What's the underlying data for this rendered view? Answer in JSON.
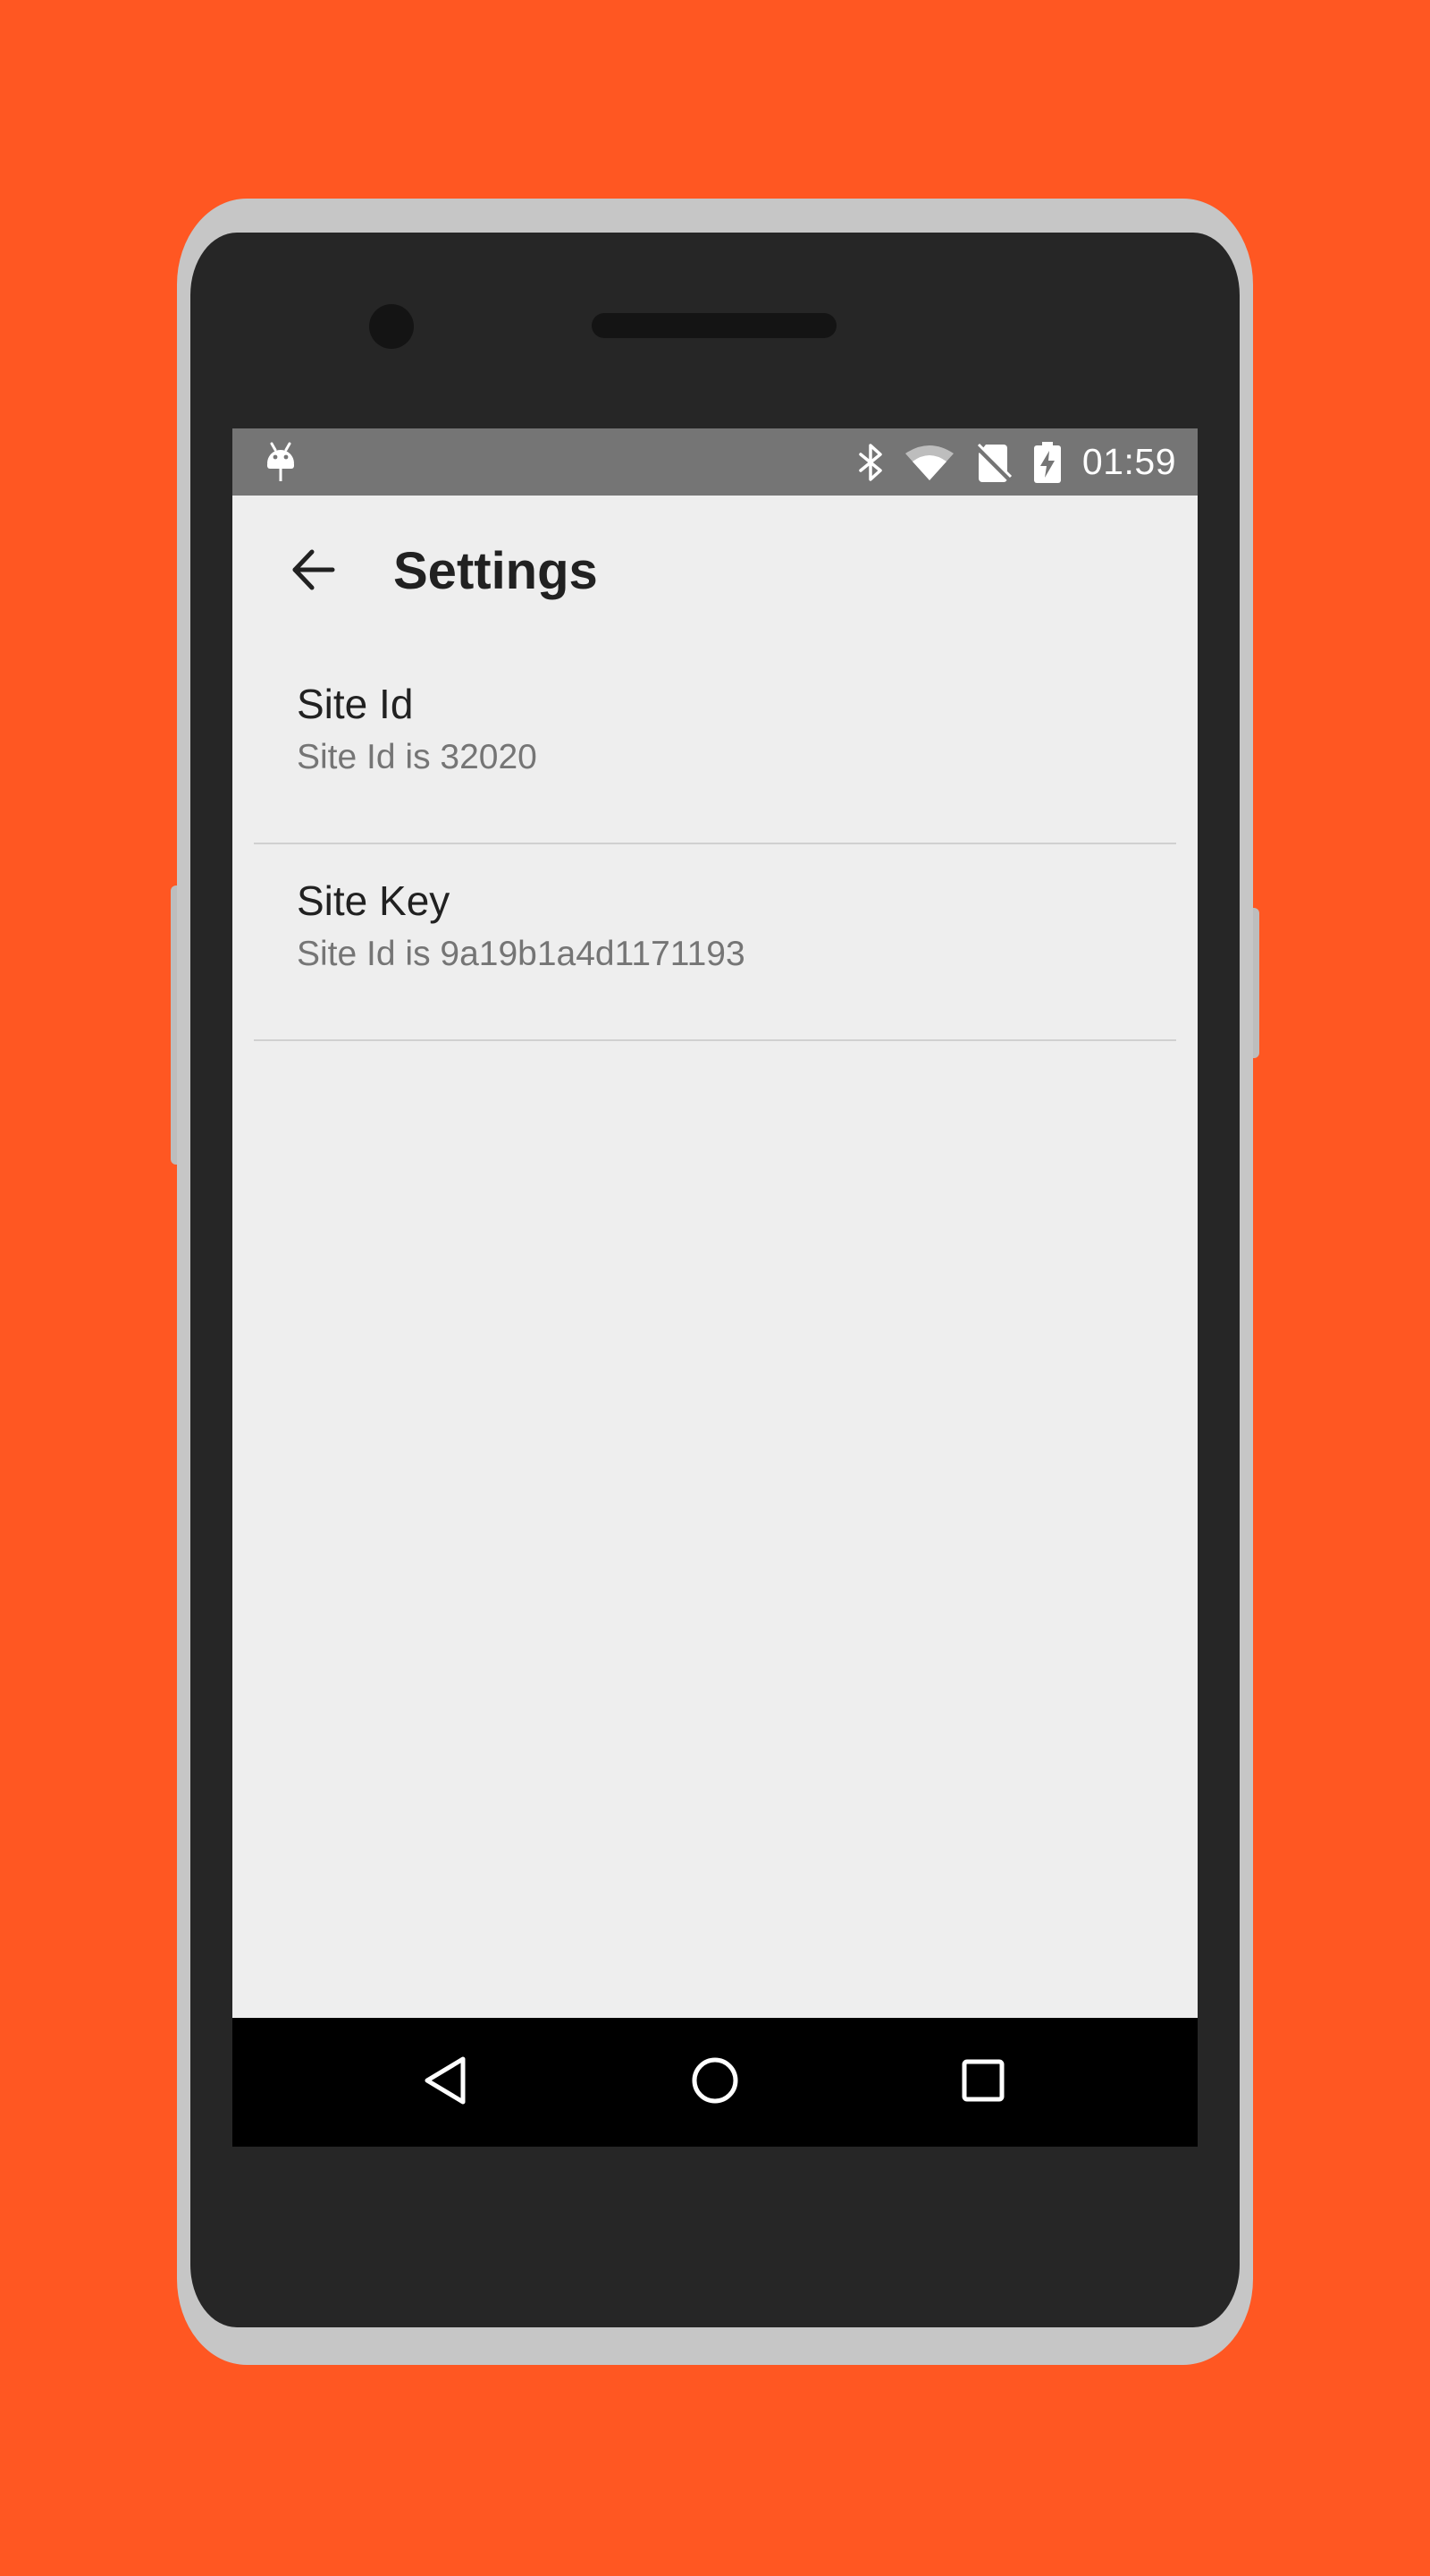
{
  "theme": {
    "background": "#FF5722",
    "status_bar": "#757575",
    "screen_background": "#EEEEEE",
    "nav_bar": "#000000"
  },
  "status_bar": {
    "time": "01:59",
    "icons": [
      "android-debug-icon",
      "bluetooth-icon",
      "wifi-icon",
      "no-sim-icon",
      "battery-charging-icon"
    ]
  },
  "app_bar": {
    "title": "Settings",
    "back_icon": "arrow-back-icon"
  },
  "preferences": [
    {
      "title": "Site Id",
      "summary": "Site Id is 32020"
    },
    {
      "title": "Site Key",
      "summary": "Site Id is 9a19b1a4d1171193"
    }
  ],
  "nav_bar": {
    "buttons": [
      "back-triangle-icon",
      "home-circle-icon",
      "recents-square-icon"
    ]
  }
}
